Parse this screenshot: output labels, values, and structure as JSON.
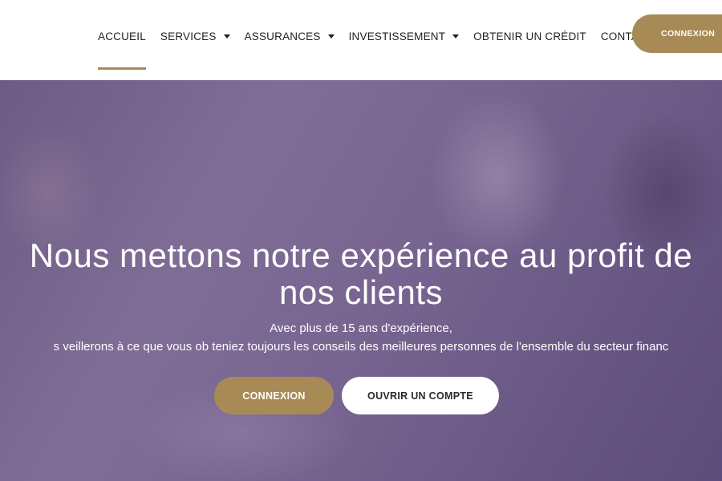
{
  "nav": {
    "items": [
      {
        "label": "ACCUEIL",
        "active": true,
        "dropdown": false
      },
      {
        "label": "SERVICES",
        "active": false,
        "dropdown": true
      },
      {
        "label": "ASSURANCES",
        "active": false,
        "dropdown": true
      },
      {
        "label": "INVESTISSEMENT",
        "active": false,
        "dropdown": true
      },
      {
        "label": "OBTENIR UN CRÉDIT",
        "active": false,
        "dropdown": false
      },
      {
        "label": "CONTACT",
        "active": false,
        "dropdown": false
      }
    ],
    "login_label": "CONNEXION"
  },
  "hero": {
    "title_line1": "Nous mettons notre expérience au profit de",
    "title_line2": "nos clients",
    "subtitle_line1": "Avec plus de 15 ans d'expérience,",
    "subtitle_line2": "s veillerons à ce que vous ob teniez toujours les conseils des meilleures personnes de l'ensemble du secteur financ",
    "primary_button": "CONNEXION",
    "secondary_button": "OUVRIR UN COMPTE"
  },
  "colors": {
    "accent": "#a88a57",
    "overlay": "#604e87",
    "nav_text": "#1f1f1f"
  },
  "icons": {
    "dropdown": "caret-down-icon"
  }
}
